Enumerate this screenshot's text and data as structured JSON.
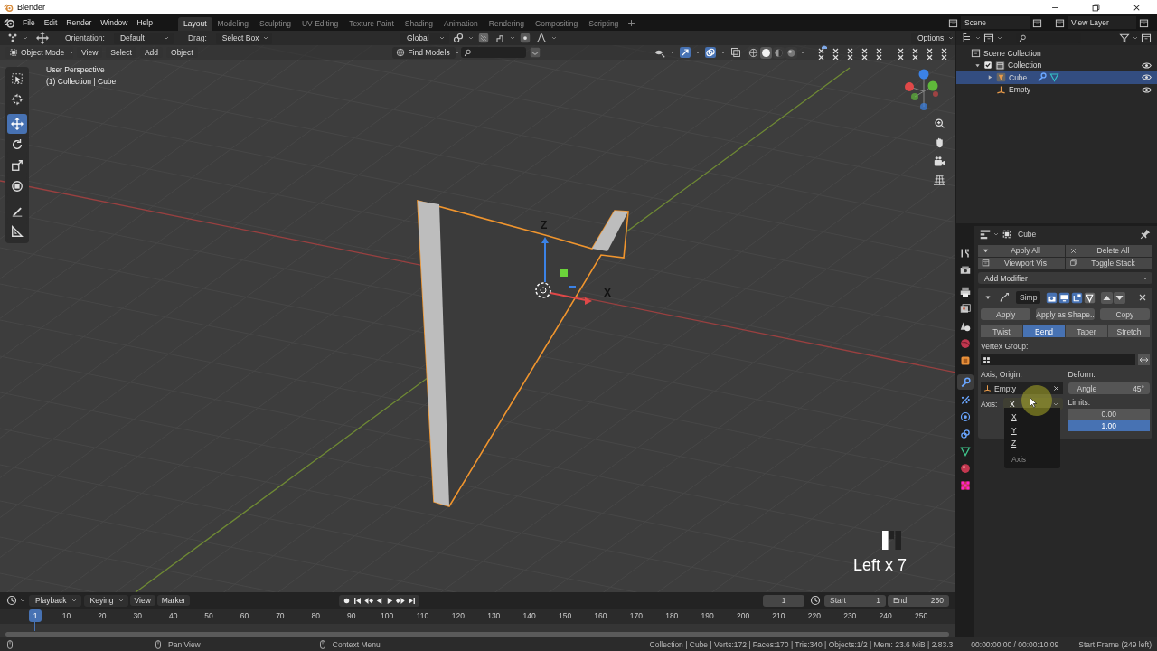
{
  "window": {
    "title": "Blender"
  },
  "menu": [
    "File",
    "Edit",
    "Render",
    "Window",
    "Help"
  ],
  "workspaces": [
    {
      "label": "Layout",
      "selected": true
    },
    {
      "label": "Modeling",
      "selected": false
    },
    {
      "label": "Sculpting",
      "selected": false
    },
    {
      "label": "UV Editing",
      "selected": false
    },
    {
      "label": "Texture Paint",
      "selected": false
    },
    {
      "label": "Shading",
      "selected": false
    },
    {
      "label": "Animation",
      "selected": false
    },
    {
      "label": "Rendering",
      "selected": false
    },
    {
      "label": "Compositing",
      "selected": false
    },
    {
      "label": "Scripting",
      "selected": false
    }
  ],
  "scene": "Scene",
  "view_layer": "View Layer",
  "viewport": {
    "header": {
      "orientation_label": "Orientation:",
      "orientation": "Default",
      "drag_label": "Drag:",
      "drag": "Select Box",
      "transform_orientation": "Global",
      "options": "Options",
      "mode": "Object Mode",
      "menus": [
        "View",
        "Select",
        "Add",
        "Object"
      ],
      "find": "Find Models"
    },
    "shading_modes": [
      {
        "kind": "wireframe",
        "selected": false
      },
      {
        "kind": "solid",
        "selected": true
      },
      {
        "kind": "material",
        "selected": false
      },
      {
        "kind": "rendered",
        "selected": false
      }
    ],
    "overlay_text": [
      "User Perspective",
      "(1) Collection | Cube"
    ],
    "tools": [
      {
        "kind": "select",
        "selected": false
      },
      {
        "kind": "cursor",
        "selected": false
      },
      {
        "kind": "move",
        "selected": true
      },
      {
        "kind": "rotate",
        "selected": false
      },
      {
        "kind": "scale",
        "selected": false
      },
      {
        "kind": "transform",
        "selected": false
      },
      {
        "kind": "annotate",
        "selected": false
      },
      {
        "kind": "measure",
        "selected": false
      }
    ],
    "axis_labels": [
      "Z",
      "X"
    ],
    "key_overlay": "Left x 7"
  },
  "outliner": {
    "items": [
      {
        "label": "Scene Collection",
        "kind": "scene",
        "selected": false,
        "children": [
          {
            "label": "Collection",
            "kind": "collection",
            "checked": true,
            "expanded": true,
            "selected": false,
            "children": [
              {
                "label": "Cube",
                "kind": "mesh",
                "expanded": false,
                "selected": true
              },
              {
                "label": "Empty",
                "kind": "empty",
                "selected": false
              }
            ]
          }
        ]
      }
    ]
  },
  "properties": {
    "tabs": [
      {
        "kind": "tool",
        "selected": false
      },
      {
        "kind": "render",
        "selected": false
      },
      {
        "kind": "output",
        "selected": false
      },
      {
        "kind": "view_layer",
        "selected": false
      },
      {
        "kind": "scene",
        "selected": false
      },
      {
        "kind": "world",
        "selected": false
      },
      {
        "kind": "object",
        "selected": false
      },
      {
        "kind": "modifier",
        "selected": true
      },
      {
        "kind": "particles",
        "selected": false
      },
      {
        "kind": "physics",
        "selected": false
      },
      {
        "kind": "constraints",
        "selected": false
      },
      {
        "kind": "data",
        "selected": false
      },
      {
        "kind": "material",
        "selected": false
      },
      {
        "kind": "texture",
        "selected": false
      }
    ],
    "object": "Cube",
    "stack_buttons": [
      "Apply All",
      "Delete All",
      "Viewport Vis",
      "Toggle Stack"
    ],
    "add_modifier": "Add Modifier",
    "modifier": {
      "name": "Simp",
      "expanded": true,
      "actions": [
        "Apply",
        "Apply as Shape..",
        "Copy"
      ],
      "methods": [
        {
          "label": "Twist",
          "selected": false
        },
        {
          "label": "Bend",
          "selected": true
        },
        {
          "label": "Taper",
          "selected": false
        },
        {
          "label": "Stretch",
          "selected": false
        }
      ],
      "vertex_group_label": "Vertex Group:",
      "origin_label": "Axis, Origin:",
      "origin": "Empty",
      "deform_label": "Deform:",
      "angle_label": "Angle",
      "angle": "45°",
      "axis_label": "Axis:",
      "axis": "X",
      "limits_label": "Limits:",
      "limits": [
        {
          "value": "0.00",
          "highlighted": false
        },
        {
          "value": "1.00",
          "highlighted": true
        }
      ],
      "axis_menu": {
        "options": [
          "X",
          "Y",
          "Z"
        ],
        "title": "Axis"
      }
    }
  },
  "timeline": {
    "menus": [
      "Playback",
      "Keying",
      "View",
      "Marker"
    ],
    "playhead_frame": "1",
    "current_frame": "1",
    "start_label": "Start",
    "start": "1",
    "end_label": "End",
    "end": "250",
    "ruler": [
      "10",
      "20",
      "30",
      "40",
      "50",
      "60",
      "70",
      "80",
      "90",
      "100",
      "110",
      "120",
      "130",
      "140",
      "150",
      "160",
      "170",
      "180",
      "190",
      "200",
      "210",
      "220",
      "230",
      "240",
      "250"
    ]
  },
  "status_bar": {
    "hints": [
      "Pan View",
      "Context Menu"
    ],
    "stats": "Collection | Cube | Verts:172 | Faces:170 | Tris:340 | Objects:1/2 | Mem: 23.6 MiB | 2.83.3",
    "time": "00:00:00:00 / 00:00:10:09",
    "frame_info": "Start Frame (249 left)"
  }
}
